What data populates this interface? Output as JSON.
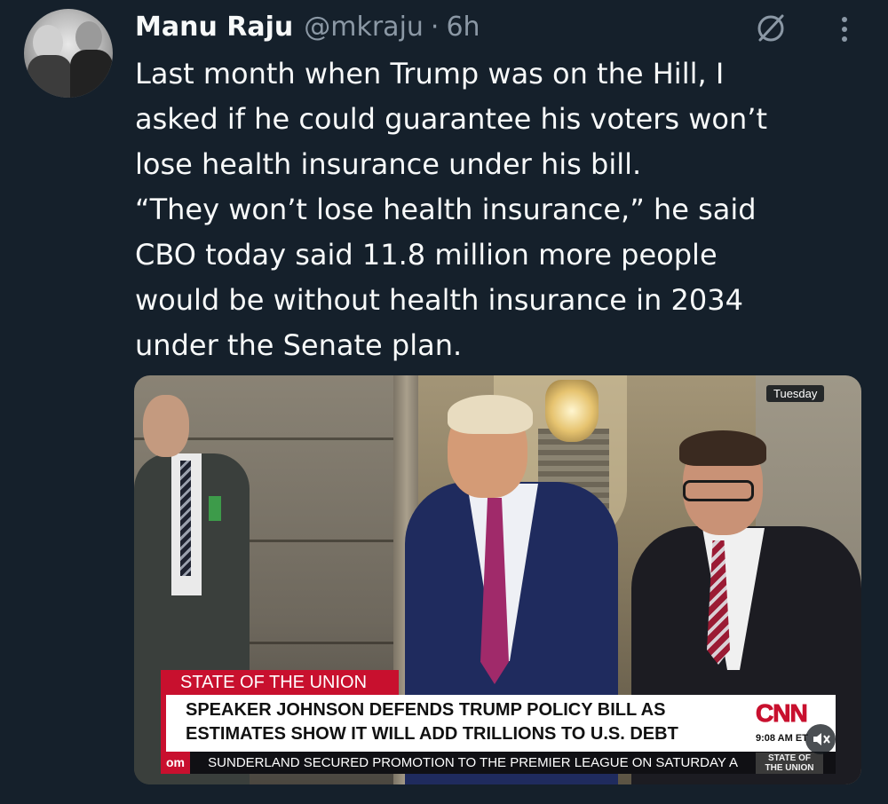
{
  "author": {
    "name": "Manu Raju",
    "handle": "@mkraju",
    "separator": "·",
    "time": "6h"
  },
  "tweet": {
    "lines": [
      "Last month when Trump was on the Hill, I",
      "asked if he could guarantee his voters won’t",
      "lose health insurance under his bill.",
      "“They won’t lose health insurance,” he said",
      "CBO today said 11.8 million more people",
      "would be without health insurance in 2034",
      "under the Senate plan."
    ]
  },
  "media": {
    "timestamp_badge": "Tuesday",
    "chyron": {
      "label": "STATE OF THE UNION",
      "headline_line1": "SPEAKER JOHNSON DEFENDS TRUMP POLICY BILL AS",
      "headline_line2": "ESTIMATES SHOW IT WILL ADD TRILLIONS TO U.S. DEBT",
      "network_logo": "CNN",
      "clock": "9:08 AM ET"
    },
    "ticker": {
      "tag": "om",
      "text": "SUNDERLAND SECURED PROMOTION TO THE PREMIER LEAGUE ON SATURDAY A",
      "show_logo_line1": "STATE OF",
      "show_logo_line2": "THE UNION"
    }
  },
  "icons": {
    "grok": "grok-icon",
    "more": "more-options-icon",
    "mute": "mute-icon"
  },
  "colors": {
    "background": "#15202b",
    "text_primary": "#f7f9f9",
    "text_secondary": "#8b98a5",
    "cnn_red": "#c8102e"
  }
}
